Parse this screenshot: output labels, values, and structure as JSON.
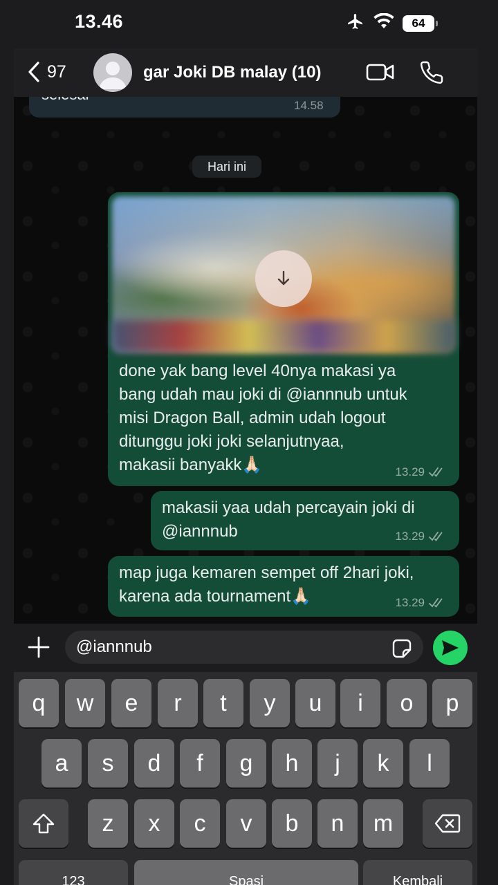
{
  "status": {
    "time": "13.46",
    "battery": "64"
  },
  "header": {
    "back_count": "97",
    "title": "gar Joki DB malay (10)"
  },
  "chat": {
    "previous": {
      "text": "selesai",
      "time": "14.58"
    },
    "date_chip": "Hari ini",
    "messages": [
      {
        "text": "done yak bang level 40nya makasi ya\nbang udah mau joki di @iannnub untuk\nmisi Dragon Ball, admin udah logout\nditunggu joki joki selanjutnyaa,\nmakasii banyakk🙏🏻",
        "time": "13.29",
        "has_media": true
      },
      {
        "text": "makasii yaa udah percayain joki di\n@iannnub",
        "time": "13.29"
      },
      {
        "text": "map juga kemaren sempet off 2hari joki,\nkarena ada tournament🙏🏻",
        "time": "13.29"
      }
    ]
  },
  "composer": {
    "value": "@iannnub"
  },
  "keyboard": {
    "row1": [
      "q",
      "w",
      "e",
      "r",
      "t",
      "y",
      "u",
      "i",
      "o",
      "p"
    ],
    "row2": [
      "a",
      "s",
      "d",
      "f",
      "g",
      "h",
      "j",
      "k",
      "l"
    ],
    "row3": [
      "z",
      "x",
      "c",
      "v",
      "b",
      "n",
      "m"
    ],
    "bottom": {
      "numbers": "123",
      "space": "Spasi",
      "return": "Kembali"
    }
  },
  "colors": {
    "outgoing_bubble": "#144d37",
    "send_button": "#25d366",
    "key": "#6b6b6d"
  }
}
